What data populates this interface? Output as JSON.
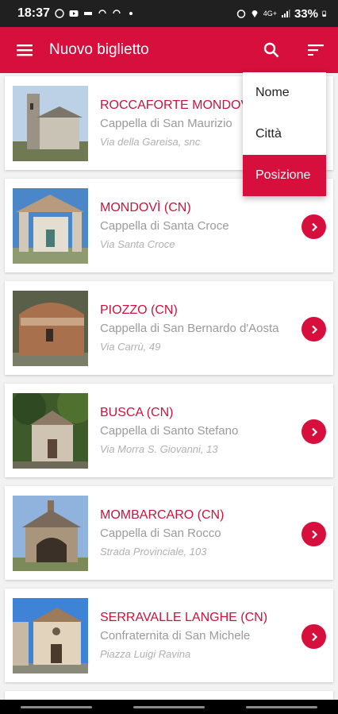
{
  "status_bar": {
    "time": "18:37",
    "left_icons": [
      "whatsapp-icon",
      "youtube-icon",
      "phone-notif-icon",
      "sync-icon",
      "sync-icon",
      "dot-icon"
    ],
    "right_icons": [
      "alarm-icon",
      "location-icon",
      "4g-icon",
      "signal-icon",
      "battery-icon"
    ],
    "network": "4G+",
    "battery": "33%"
  },
  "app_bar": {
    "title": "Nuovo biglietto",
    "menu_icon": "menu-icon",
    "search_icon": "search-icon",
    "sort_icon": "sort-icon",
    "color": "#d60f3c"
  },
  "sort_menu": {
    "options": [
      "Nome",
      "Città",
      "Posizione"
    ],
    "selected": "Posizione"
  },
  "items": [
    {
      "place": "ROCCAFORTE MONDOVÌ (CN)",
      "name": "Cappella di San Maurizio",
      "address": "Via della Gareisa, snc"
    },
    {
      "place": "MONDOVÌ (CN)",
      "name": "Cappella di Santa Croce",
      "address": "Via Santa Croce"
    },
    {
      "place": "PIOZZO (CN)",
      "name": "Cappella di San Bernardo d'Aosta",
      "address": "Via Carrù, 49"
    },
    {
      "place": "BUSCA (CN)",
      "name": "Cappella di Santo Stefano",
      "address": "Via Morra S. Giovanni, 13"
    },
    {
      "place": "MOMBARCARO (CN)",
      "name": "Cappella di San Rocco",
      "address": "Strada Provinciale, 103"
    },
    {
      "place": "SERRAVALLE LANGHE (CN)",
      "name": "Confraternita di San Michele",
      "address": "Piazza Luigi Ravina"
    }
  ]
}
